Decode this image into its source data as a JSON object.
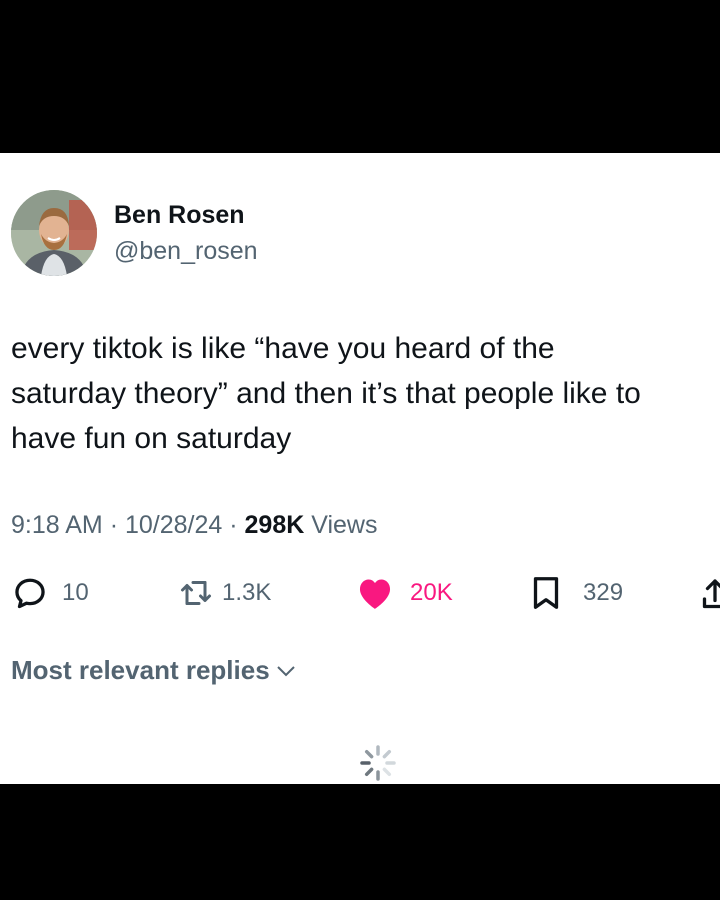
{
  "tweet": {
    "author_name": "Ben Rosen",
    "author_handle": "@ben_rosen",
    "text_lines": [
      "every tiktok is like “have you heard of the",
      "saturday theory” and then it’s that people like to",
      "have fun on saturday"
    ],
    "time": "9:18 AM",
    "date": "10/28/24",
    "separator": "·",
    "views_count": "298K",
    "views_label": "Views"
  },
  "actions": {
    "replies": {
      "icon": "reply-icon",
      "count": "10"
    },
    "reposts": {
      "icon": "repost-icon",
      "count": "1.3K"
    },
    "likes": {
      "icon": "heart-filled-icon",
      "count": "20K",
      "color": "#f91880"
    },
    "bookmarks": {
      "icon": "bookmark-icon",
      "count": "329"
    },
    "share": {
      "icon": "share-icon"
    }
  },
  "replies_section": {
    "sort_label": "Most relevant replies",
    "sort_icon": "chevron-down-icon",
    "loading_icon": "loading-spinner-icon"
  },
  "colors": {
    "text_primary": "#0f1419",
    "text_secondary": "#536471",
    "like": "#f91880",
    "background": "#ffffff",
    "frame": "#000000"
  }
}
